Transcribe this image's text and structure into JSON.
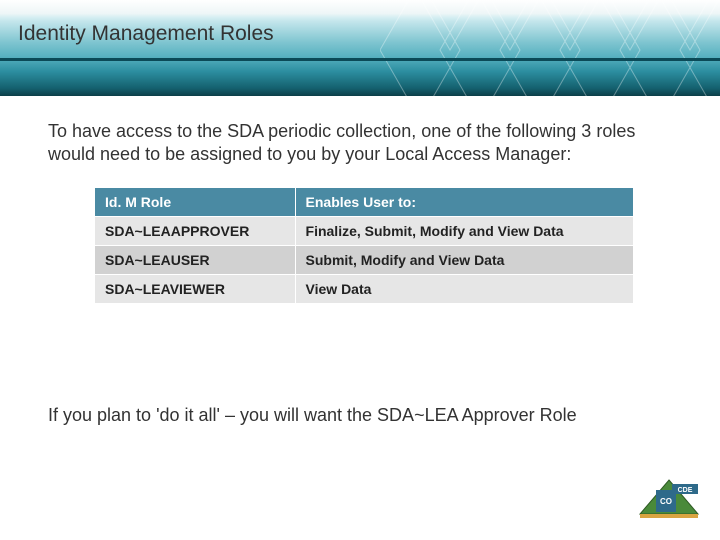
{
  "title": "Identity Management Roles",
  "intro": "To have access to the SDA periodic collection, one of the following 3 roles would need to be assigned to you by your Local Access Manager:",
  "table": {
    "headers": {
      "role": "Id. M Role",
      "enables": "Enables User to:"
    },
    "rows": [
      {
        "role": "SDA~LEAAPPROVER",
        "enables": "Finalize, Submit, Modify and View Data"
      },
      {
        "role": "SDA~LEAUSER",
        "enables": "Submit, Modify and View Data"
      },
      {
        "role": "SDA~LEAVIEWER",
        "enables": "View Data"
      }
    ]
  },
  "footnote": "If you plan to 'do it all' – you will want the SDA~LEA Approver Role",
  "logo": {
    "text_top": "CDE",
    "text_bottom": "CO"
  },
  "colors": {
    "header_teal": "#2d8fa1",
    "table_header": "#4a8aa3",
    "row_light": "#e6e6e6",
    "row_dark": "#d1d1d1"
  }
}
